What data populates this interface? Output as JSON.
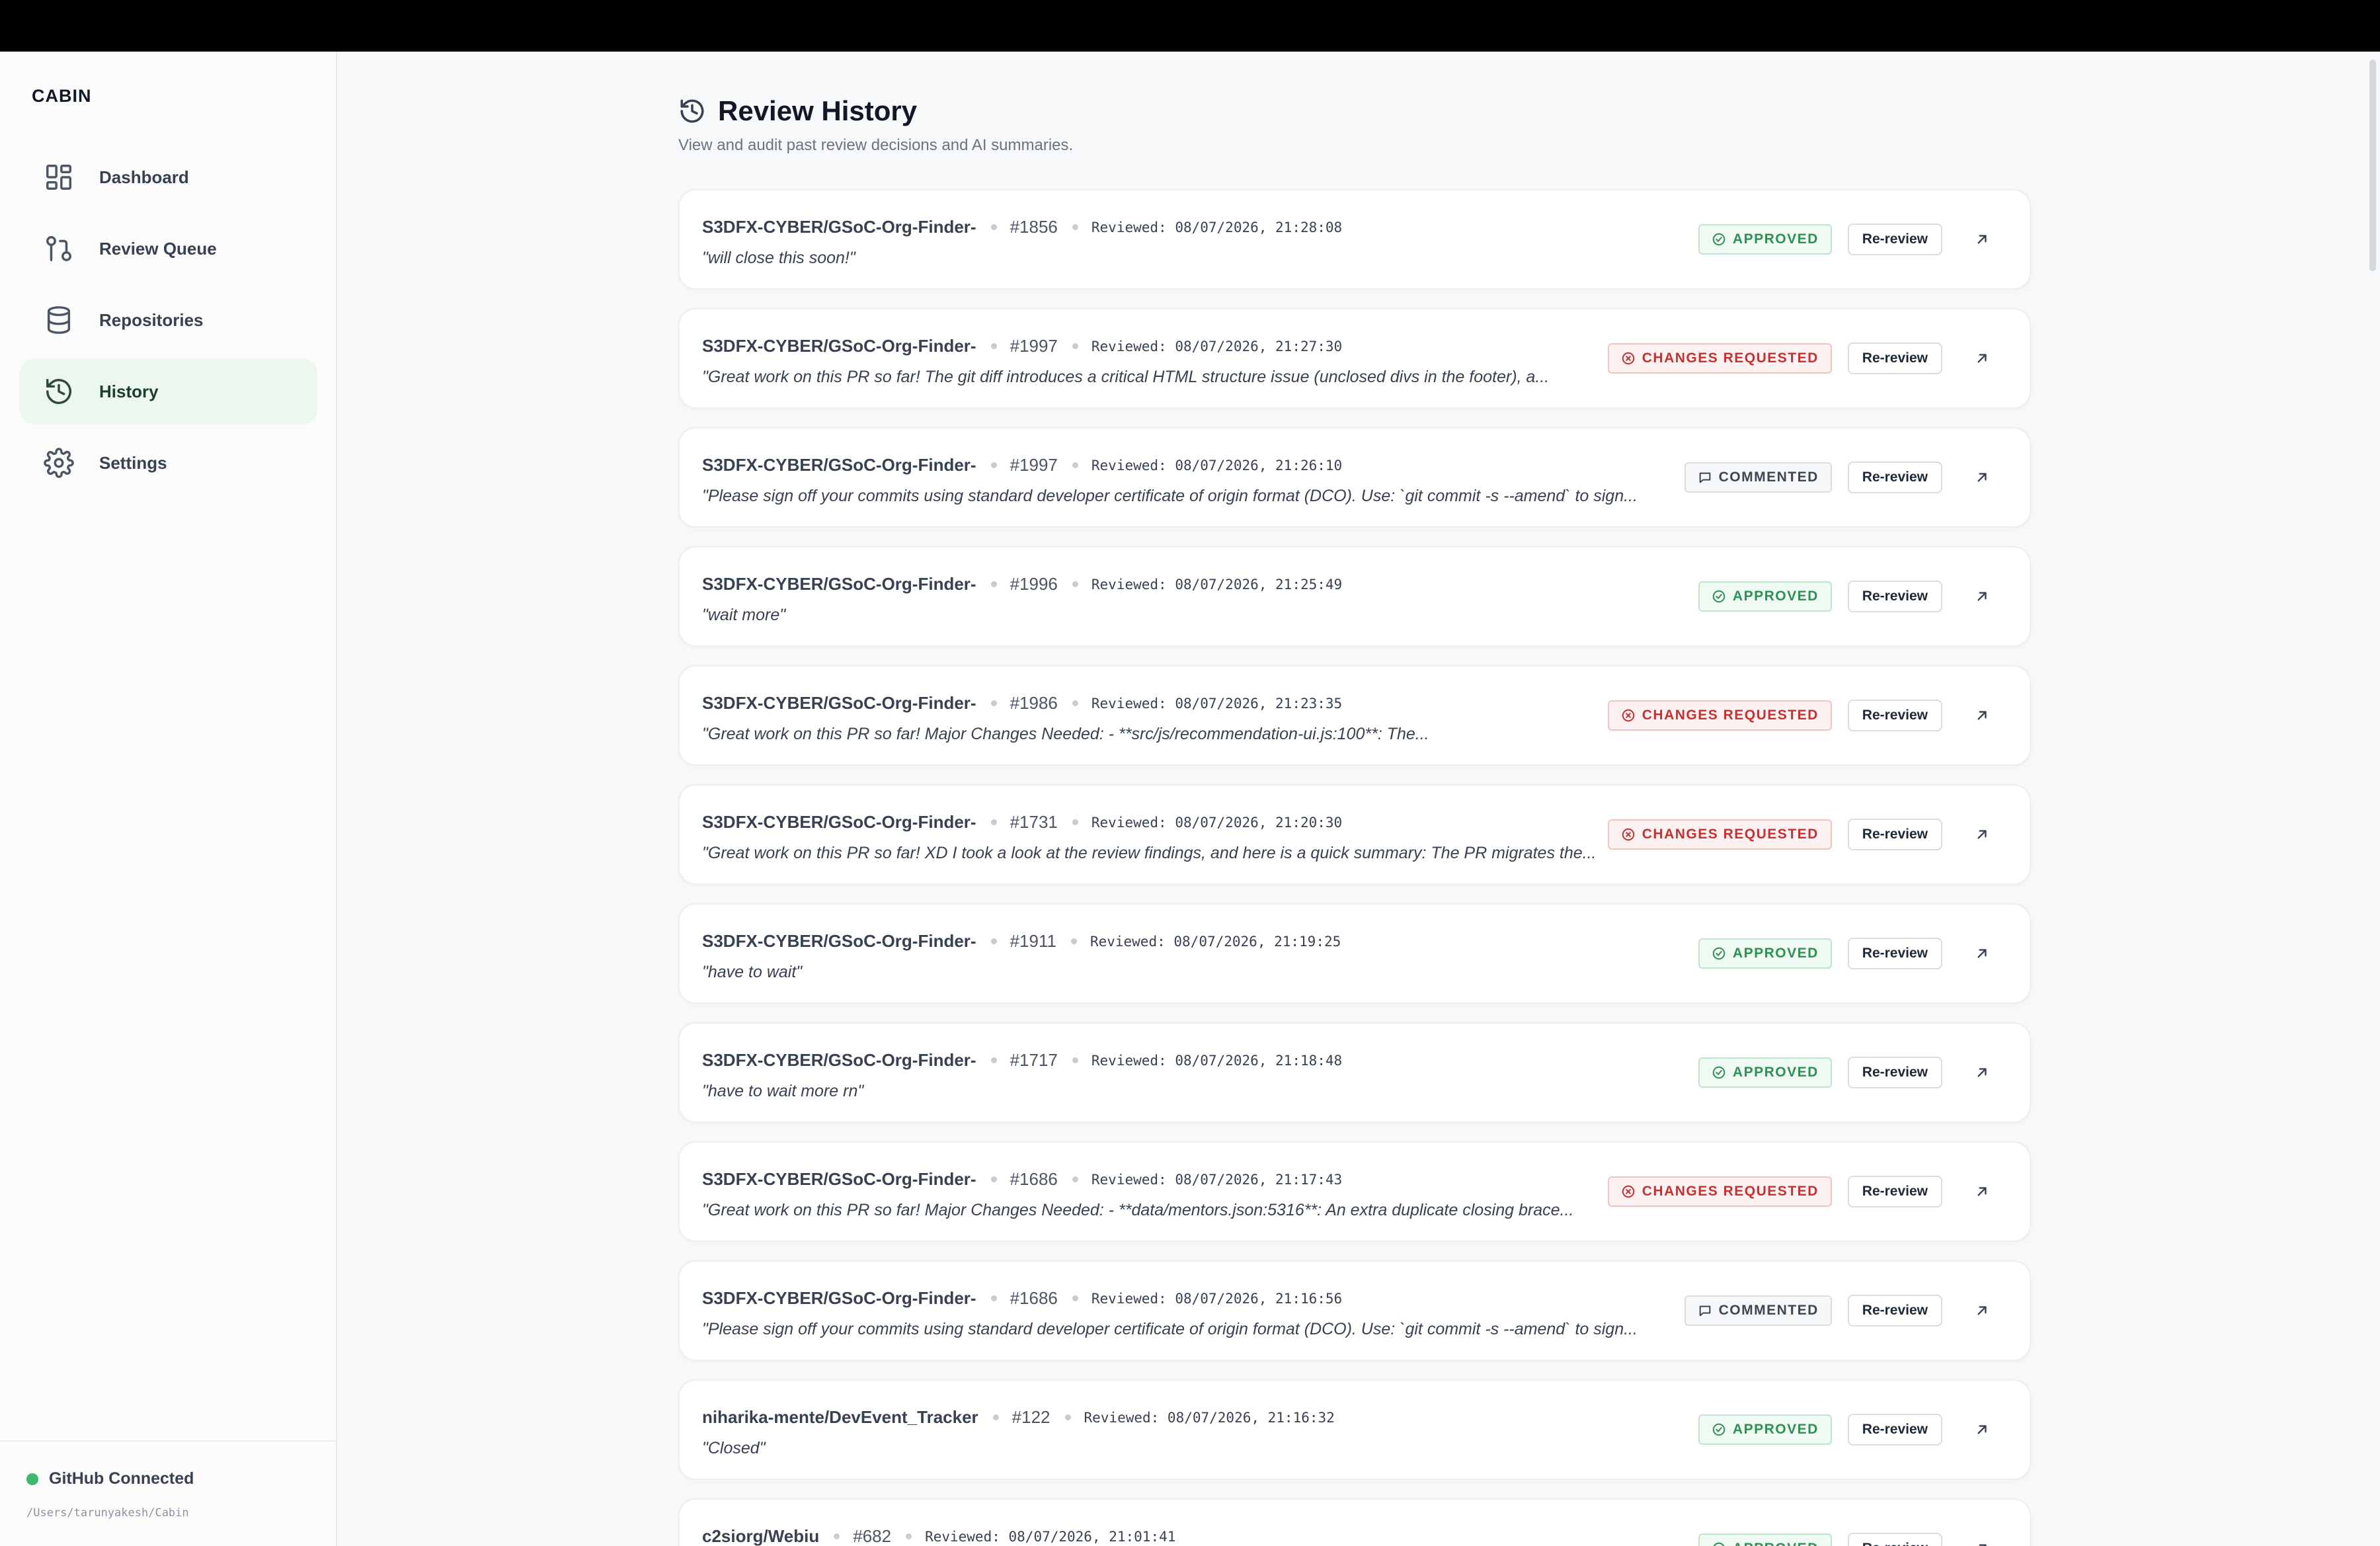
{
  "app": {
    "brand": "CABIN"
  },
  "sidebar": {
    "items": [
      {
        "label": "Dashboard",
        "icon": "dashboard-icon",
        "active": false
      },
      {
        "label": "Review Queue",
        "icon": "git-pull-request-icon",
        "active": false
      },
      {
        "label": "Repositories",
        "icon": "database-icon",
        "active": false
      },
      {
        "label": "History",
        "icon": "history-icon",
        "active": true
      },
      {
        "label": "Settings",
        "icon": "gear-icon",
        "active": false
      }
    ],
    "github": {
      "status": "GitHub Connected",
      "path": "/Users/tarunyakesh/Cabin"
    }
  },
  "page": {
    "title": "Review History",
    "subtitle": "View and audit past review decisions and AI summaries."
  },
  "labels": {
    "rereview": "Re-review"
  },
  "colors": {
    "approved": "#2f8f55",
    "changes_requested": "#c53030",
    "commented": "#3f4650",
    "active_nav_bg": "#ecf7f0"
  },
  "reviews": [
    {
      "repo": "S3DFX-CYBER/GSoC-Org-Finder-",
      "pr": "#1856",
      "reviewed": "Reviewed: 08/07/2026, 21:28:08",
      "summary": "\"will close this soon!\"",
      "status": "APPROVED",
      "kind": "approved"
    },
    {
      "repo": "S3DFX-CYBER/GSoC-Org-Finder-",
      "pr": "#1997",
      "reviewed": "Reviewed: 08/07/2026, 21:27:30",
      "summary": "\"Great work on this PR so far! The git diff introduces a critical HTML structure issue (unclosed divs in the footer), a...",
      "status": "CHANGES REQUESTED",
      "kind": "changes"
    },
    {
      "repo": "S3DFX-CYBER/GSoC-Org-Finder-",
      "pr": "#1997",
      "reviewed": "Reviewed: 08/07/2026, 21:26:10",
      "summary": "\"Please sign off your commits using standard developer certificate of origin format (DCO). Use: `git commit -s --amend` to sign...",
      "status": "COMMENTED",
      "kind": "commented"
    },
    {
      "repo": "S3DFX-CYBER/GSoC-Org-Finder-",
      "pr": "#1996",
      "reviewed": "Reviewed: 08/07/2026, 21:25:49",
      "summary": "\"wait more\"",
      "status": "APPROVED",
      "kind": "approved"
    },
    {
      "repo": "S3DFX-CYBER/GSoC-Org-Finder-",
      "pr": "#1986",
      "reviewed": "Reviewed: 08/07/2026, 21:23:35",
      "summary": "\"Great work on this PR so far! Major Changes Needed: - **src/js/recommendation-ui.js:100**: The...",
      "status": "CHANGES REQUESTED",
      "kind": "changes"
    },
    {
      "repo": "S3DFX-CYBER/GSoC-Org-Finder-",
      "pr": "#1731",
      "reviewed": "Reviewed: 08/07/2026, 21:20:30",
      "summary": "\"Great work on this PR so far! XD I took a look at the review findings, and here is a quick summary: The PR migrates the...",
      "status": "CHANGES REQUESTED",
      "kind": "changes"
    },
    {
      "repo": "S3DFX-CYBER/GSoC-Org-Finder-",
      "pr": "#1911",
      "reviewed": "Reviewed: 08/07/2026, 21:19:25",
      "summary": "\"have to wait\"",
      "status": "APPROVED",
      "kind": "approved"
    },
    {
      "repo": "S3DFX-CYBER/GSoC-Org-Finder-",
      "pr": "#1717",
      "reviewed": "Reviewed: 08/07/2026, 21:18:48",
      "summary": "\"have to wait more rn\"",
      "status": "APPROVED",
      "kind": "approved"
    },
    {
      "repo": "S3DFX-CYBER/GSoC-Org-Finder-",
      "pr": "#1686",
      "reviewed": "Reviewed: 08/07/2026, 21:17:43",
      "summary": "\"Great work on this PR so far! Major Changes Needed: - **data/mentors.json:5316**: An extra duplicate closing brace...",
      "status": "CHANGES REQUESTED",
      "kind": "changes"
    },
    {
      "repo": "S3DFX-CYBER/GSoC-Org-Finder-",
      "pr": "#1686",
      "reviewed": "Reviewed: 08/07/2026, 21:16:56",
      "summary": "\"Please sign off your commits using standard developer certificate of origin format (DCO). Use: `git commit -s --amend` to sign...",
      "status": "COMMENTED",
      "kind": "commented"
    },
    {
      "repo": "niharika-mente/DevEvent_Tracker",
      "pr": "#122",
      "reviewed": "Reviewed: 08/07/2026, 21:16:32",
      "summary": "\"Closed\"",
      "status": "APPROVED",
      "kind": "approved"
    },
    {
      "repo": "c2siorg/Webiu",
      "pr": "#682",
      "reviewed": "Reviewed: 08/07/2026, 21:01:41",
      "summary": "",
      "status": "APPROVED",
      "kind": "approved"
    }
  ]
}
